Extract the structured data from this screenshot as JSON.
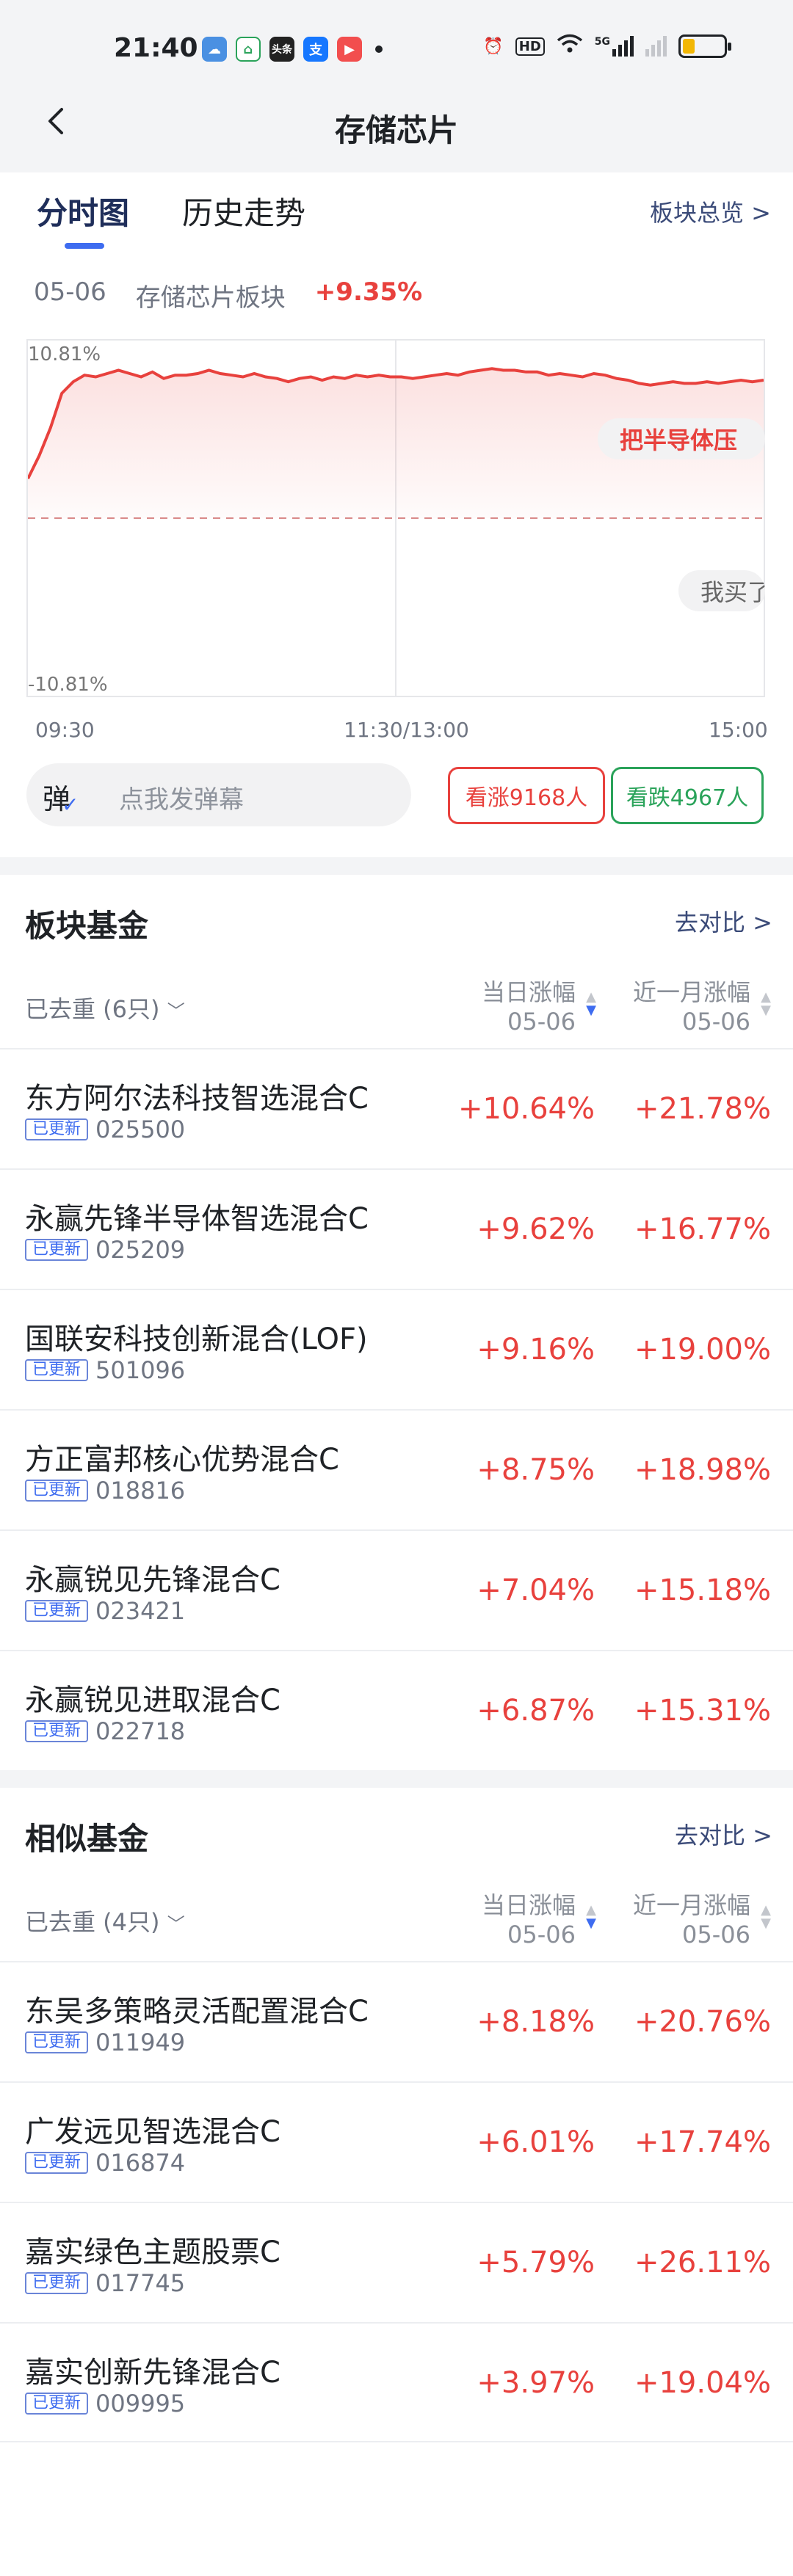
{
  "status_bar": {
    "time": "21:40",
    "app_icons": [
      "weather-icon",
      "home-icon",
      "toutiao-icon",
      "alipay-icon",
      "video-icon"
    ],
    "app_labels": [
      "",
      "",
      "头条",
      "支",
      ""
    ],
    "right_labels": [
      "HD",
      "5G"
    ],
    "battery_level": 0.3
  },
  "header": {
    "title": "存储芯片"
  },
  "tabs": {
    "items": [
      {
        "label": "分时图"
      },
      {
        "label": "历史走势"
      }
    ],
    "overview_link": "板块总览 >"
  },
  "chart_info": {
    "date": "05-06",
    "sector": "存储芯片板块",
    "change": "+9.35%"
  },
  "chart_data": {
    "type": "line",
    "y_top_label": "10.81%",
    "y_bottom_label": "-10.81%",
    "ylim": [
      -10.81,
      10.81
    ],
    "x_ticks": [
      "09:30",
      "11:30/13:00",
      "15:00"
    ],
    "series": [
      {
        "values": [
          2.4,
          3.8,
          5.5,
          7.6,
          8.3,
          8.7,
          8.6,
          8.8,
          9.0,
          8.8,
          8.6,
          8.9,
          8.5,
          8.7,
          8.7,
          8.8,
          9.0,
          8.8,
          8.7,
          8.6,
          8.8,
          8.6,
          8.5,
          8.3,
          8.5,
          8.6,
          8.4,
          8.6,
          8.5,
          8.7,
          8.6,
          8.7,
          8.6,
          8.6,
          8.5,
          8.6,
          8.7,
          8.8,
          8.7,
          8.9,
          9.0,
          9.1,
          9.0,
          9.0,
          8.9,
          8.9,
          8.7,
          8.8,
          8.7,
          8.6,
          8.8,
          8.7,
          8.5,
          8.4,
          8.2,
          8.1,
          8.2,
          8.3,
          8.2,
          8.2,
          8.3,
          8.2,
          8.3,
          8.4,
          8.3,
          8.4
        ]
      }
    ],
    "danmu": [
      "把半导体压",
      "我买了"
    ]
  },
  "comment": {
    "icon_label": "弹",
    "placeholder": "点我发弹幕"
  },
  "votes": {
    "up": "看涨9168人",
    "down": "看跌4967人"
  },
  "sector_funds": {
    "title": "板块基金",
    "compare": "去对比 >",
    "filter": "已去重 (6只)",
    "col1": "当日涨幅",
    "col1_date": "05-06",
    "col2": "近一月涨幅",
    "col2_date": "05-06",
    "rows": [
      {
        "name": "东方阿尔法科技智选混合C",
        "badge": "已更新",
        "code": "025500",
        "day": "+10.64%",
        "month": "+21.78%"
      },
      {
        "name": "永赢先锋半导体智选混合C",
        "badge": "已更新",
        "code": "025209",
        "day": "+9.62%",
        "month": "+16.77%"
      },
      {
        "name": "国联安科技创新混合(LOF)",
        "badge": "已更新",
        "code": "501096",
        "day": "+9.16%",
        "month": "+19.00%"
      },
      {
        "name": "方正富邦核心优势混合C",
        "badge": "已更新",
        "code": "018816",
        "day": "+8.75%",
        "month": "+18.98%"
      },
      {
        "name": "永赢锐见先锋混合C",
        "badge": "已更新",
        "code": "023421",
        "day": "+7.04%",
        "month": "+15.18%"
      },
      {
        "name": "永赢锐见进取混合C",
        "badge": "已更新",
        "code": "022718",
        "day": "+6.87%",
        "month": "+15.31%"
      }
    ]
  },
  "similar_funds": {
    "title": "相似基金",
    "compare": "去对比 >",
    "filter": "已去重 (4只)",
    "col1": "当日涨幅",
    "col1_date": "05-06",
    "col2": "近一月涨幅",
    "col2_date": "05-06",
    "rows": [
      {
        "name": "东吴多策略灵活配置混合C",
        "badge": "已更新",
        "code": "011949",
        "day": "+8.18%",
        "month": "+20.76%"
      },
      {
        "name": "广发远见智选混合C",
        "badge": "已更新",
        "code": "016874",
        "day": "+6.01%",
        "month": "+17.74%"
      },
      {
        "name": "嘉实绿色主题股票C",
        "badge": "已更新",
        "code": "017745",
        "day": "+5.79%",
        "month": "+26.11%"
      },
      {
        "name": "嘉实创新先锋混合C",
        "badge": "已更新",
        "code": "009995",
        "day": "+3.97%",
        "month": "+19.04%"
      }
    ]
  },
  "colors": {
    "up": "#e8413d",
    "down": "#2aa35a",
    "accent": "#3e6cf0"
  }
}
